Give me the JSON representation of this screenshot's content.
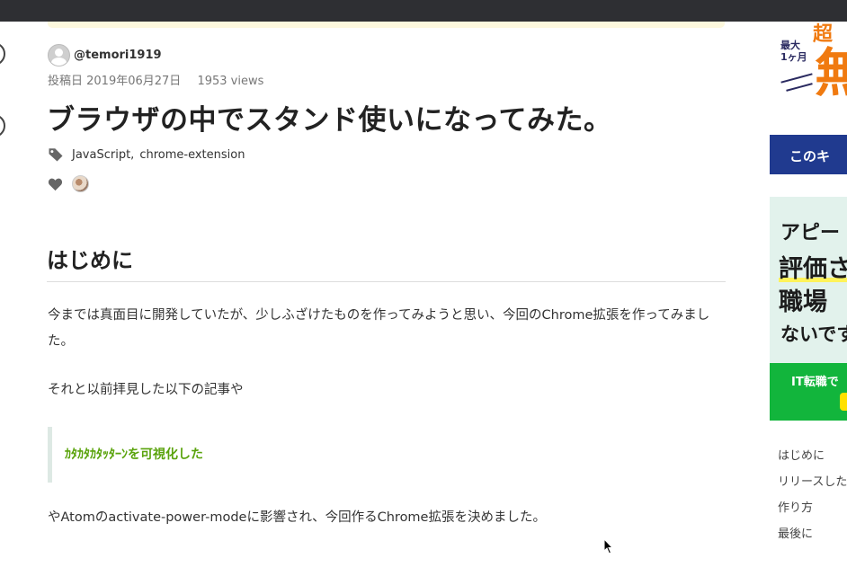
{
  "author": {
    "name": "@temori1919"
  },
  "meta": {
    "posted_label": "投稿日 2019年06月27日",
    "views": "1953 views"
  },
  "article": {
    "title": "ブラウザの中でスタンド使いになってみた。",
    "tags": [
      "JavaScript",
      "chrome-extension"
    ],
    "tag_separator": ",",
    "heading": "はじめに",
    "paragraph1": "今までは真面目に開発していたが、少しふざけたものを作ってみようと思い、今回のChrome拡張を作ってみました。",
    "paragraph2": "それと以前拝見した以下の記事や",
    "quote_link": "ｶﾀｶﾀｶﾀｯﾀｰﾝを可視化した",
    "paragraph3": "やAtomのactivate-power-modeに影響され、今回作るChrome拡張を決めました。"
  },
  "ads": {
    "ad1": {
      "top_small": "最大\n1ヶ月",
      "top_big": "無",
      "top_prefix": "超",
      "bar_text": "このキ"
    },
    "ad2": {
      "line1": "アピー",
      "line2": "評価さ",
      "line3": "職場",
      "line4": "ないです",
      "cta": "IT転職で"
    }
  },
  "toc": [
    "はじめに",
    "リリースした",
    "作り方",
    "最後に"
  ],
  "colors": {
    "topbar": "#2e2f33",
    "link_green": "#5aa30c",
    "ad_blue": "#203a8f",
    "ad_green": "#12b53c",
    "ad_orange": "#f07a10"
  }
}
